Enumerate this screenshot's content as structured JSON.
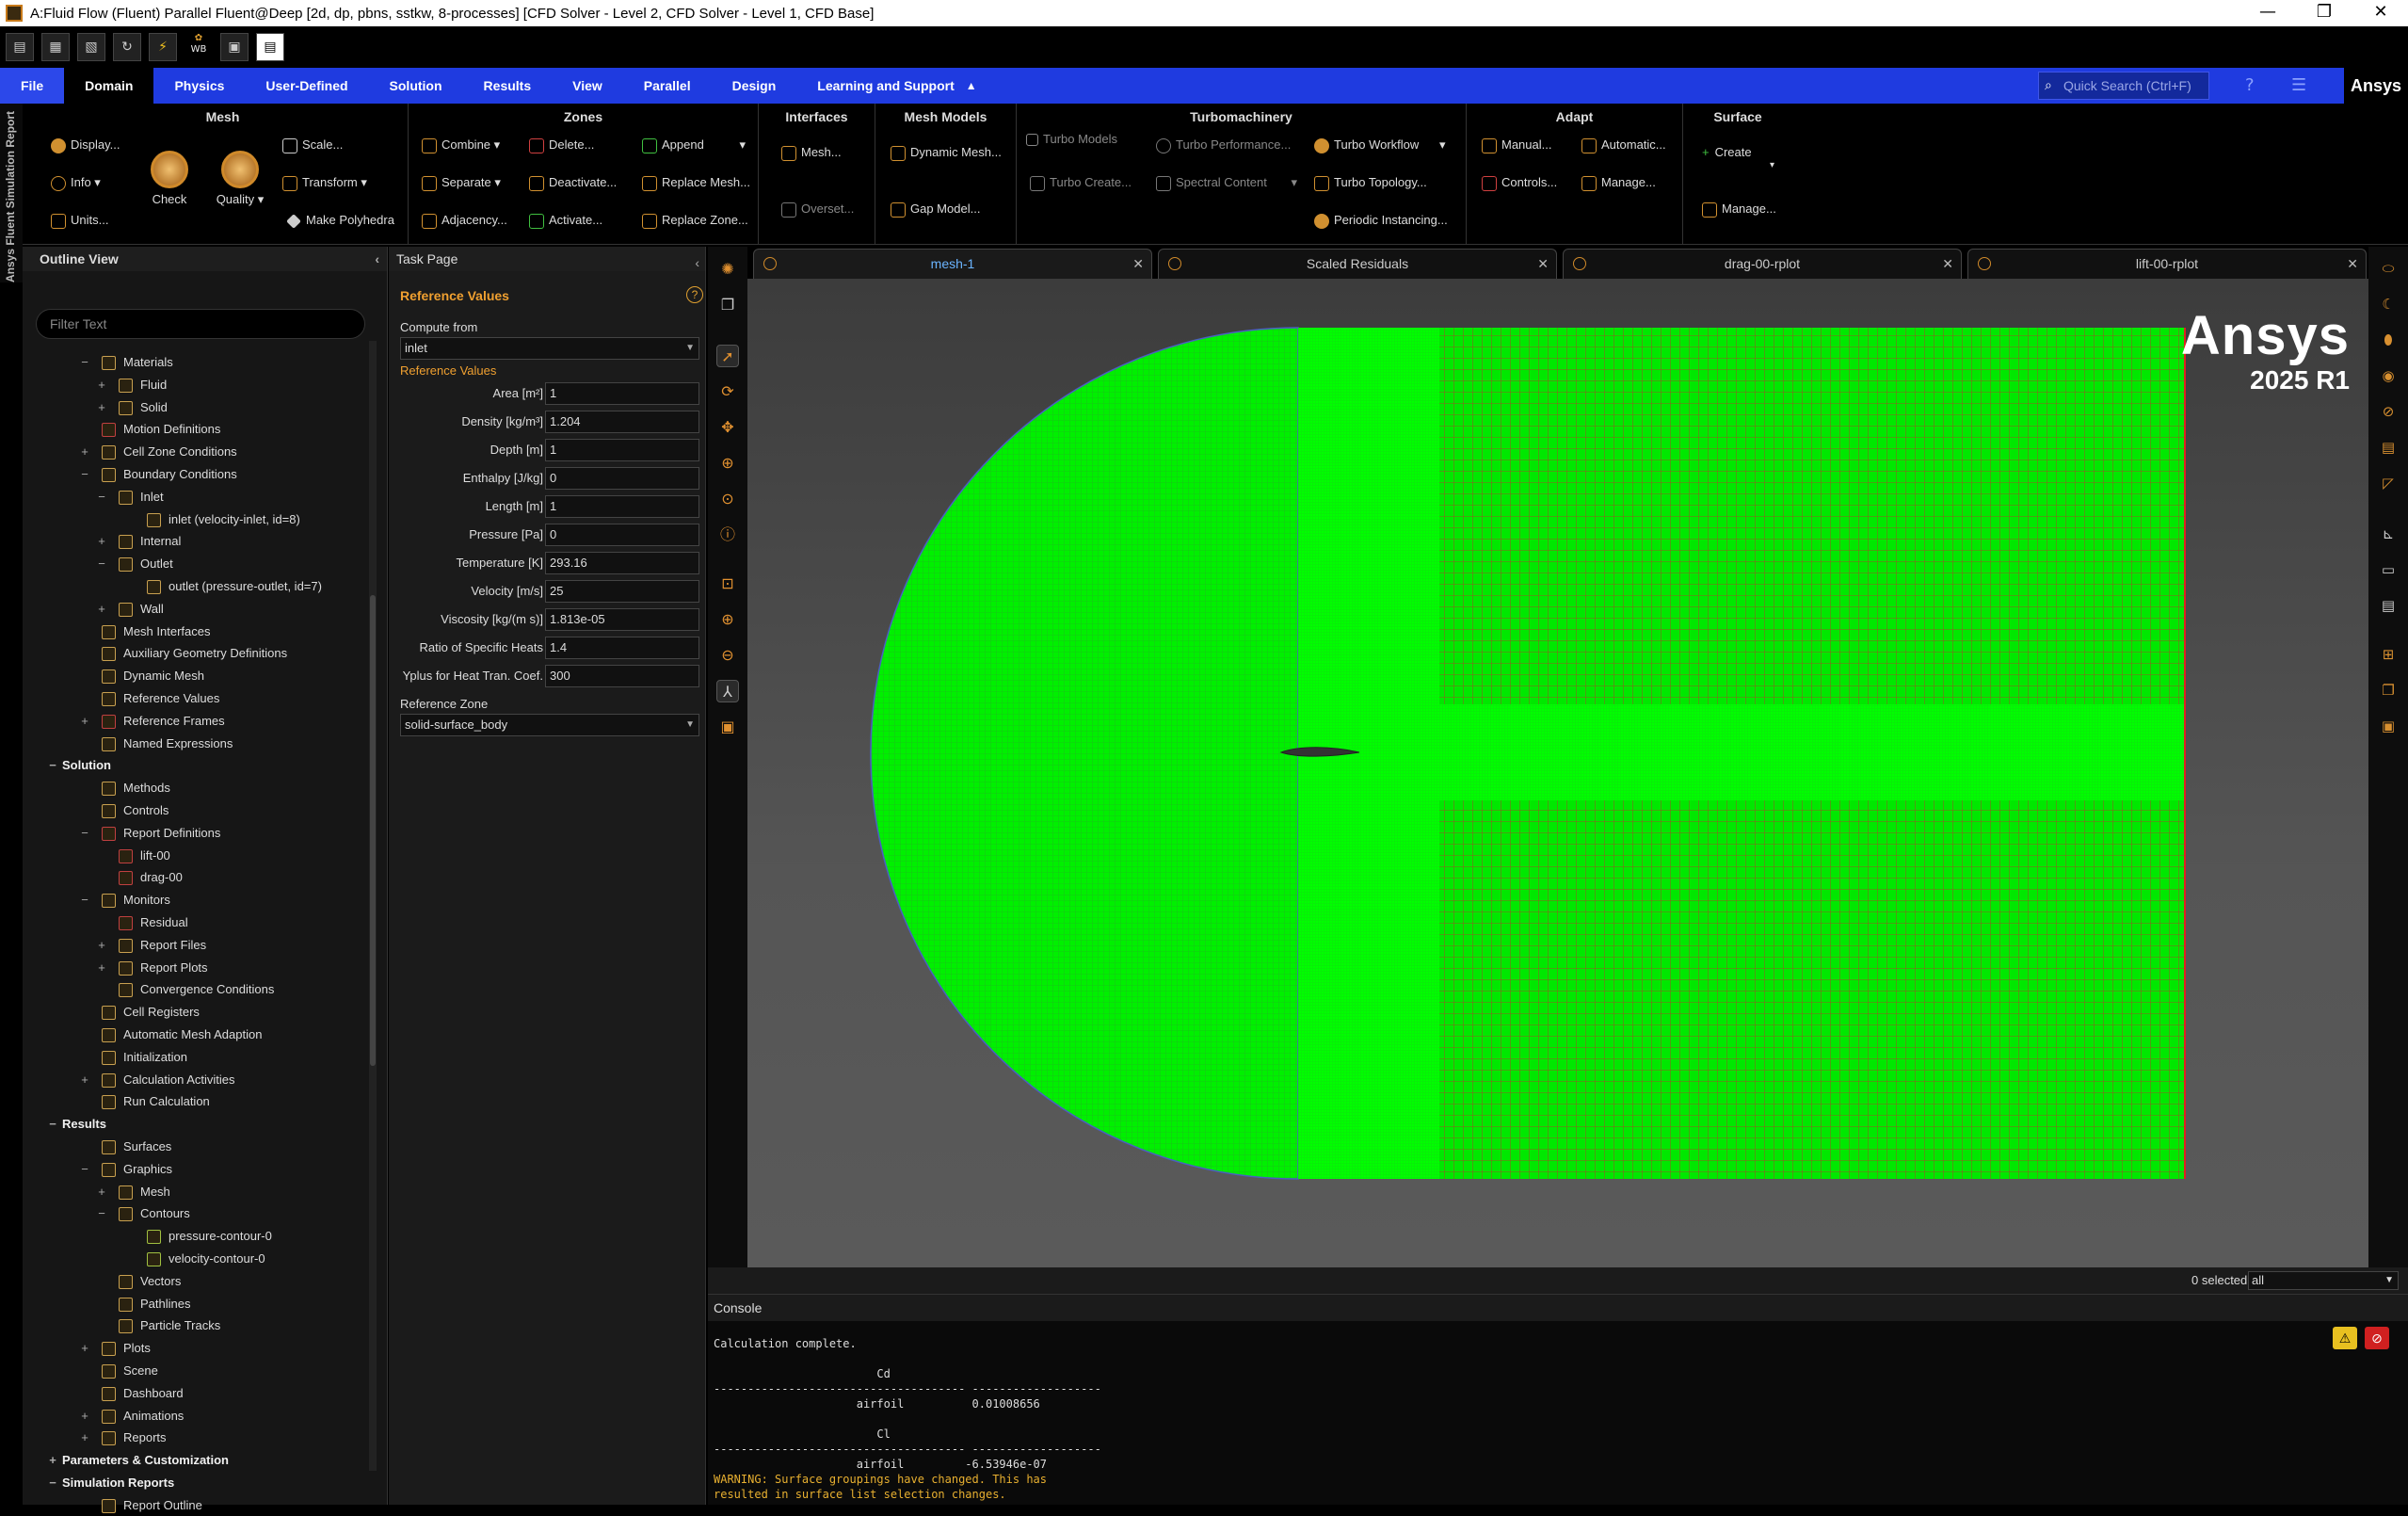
{
  "window": {
    "title": "A:Fluid Flow (Fluent) Parallel Fluent@Deep  [2d, dp, pbns, sstkw, 8-processes] [CFD Solver - Level 2, CFD Solver - Level 1, CFD Base]",
    "minimize": "—",
    "maximize": "❐",
    "close": "✕"
  },
  "qat": {
    "wb_label": "WB"
  },
  "menu": {
    "tabs": [
      "File",
      "Domain",
      "Physics",
      "User-Defined",
      "Solution",
      "Results",
      "View",
      "Parallel",
      "Design",
      "Learning and Support"
    ],
    "active": "Domain",
    "collapse": "▲",
    "search_placeholder": "Quick Search (Ctrl+F)",
    "brand": "Ansys"
  },
  "ribbon": {
    "mesh": {
      "title": "Mesh",
      "display": "Display...",
      "info": "Info",
      "units": "Units...",
      "check": "Check",
      "quality": "Quality",
      "scale": "Scale...",
      "transform": "Transform",
      "make_polyhedra": "Make Polyhedra"
    },
    "zones": {
      "title": "Zones",
      "combine": "Combine",
      "separate": "Separate",
      "adjacency": "Adjacency...",
      "delete": "Delete...",
      "deactivate": "Deactivate...",
      "activate": "Activate...",
      "append": "Append",
      "replace_mesh": "Replace Mesh...",
      "replace_zone": "Replace Zone..."
    },
    "interfaces": {
      "title": "Interfaces",
      "mesh": "Mesh...",
      "overset": "Overset..."
    },
    "mesh_models": {
      "title": "Mesh Models",
      "dynamic_mesh": "Dynamic Mesh...",
      "gap_model": "Gap Model..."
    },
    "turbomachinery": {
      "title": "Turbomachinery",
      "turbo_models": "Turbo Models",
      "turbo_create": "Turbo Create...",
      "turbo_performance": "Turbo Performance...",
      "spectral_content": "Spectral Content",
      "turbo_workflow": "Turbo Workflow",
      "turbo_topology": "Turbo Topology...",
      "periodic_instancing": "Periodic Instancing..."
    },
    "adapt": {
      "title": "Adapt",
      "manual": "Manual...",
      "automatic": "Automatic...",
      "controls": "Controls...",
      "manage": "Manage..."
    },
    "surface": {
      "title": "Surface",
      "create": "Create",
      "manage": "Manage..."
    }
  },
  "side_tab": "Ansys Fluent Simulation Report",
  "outline": {
    "title": "Outline View",
    "filter_placeholder": "Filter Text",
    "items": [
      {
        "label": "Materials",
        "exp": "−",
        "indent": 1,
        "color": "#c8a050"
      },
      {
        "label": "Fluid",
        "exp": "+",
        "indent": 2,
        "color": "#c8a050"
      },
      {
        "label": "Solid",
        "exp": "+",
        "indent": 2,
        "color": "#c8a050"
      },
      {
        "label": "Motion Definitions",
        "exp": "",
        "indent": 1,
        "color": "#c04040"
      },
      {
        "label": "Cell Zone Conditions",
        "exp": "+",
        "indent": 1,
        "color": "#c8a050"
      },
      {
        "label": "Boundary Conditions",
        "exp": "−",
        "indent": 1,
        "color": "#c8a050"
      },
      {
        "label": "Inlet",
        "exp": "−",
        "indent": 2,
        "color": "#c8a050"
      },
      {
        "label": "inlet (velocity-inlet, id=8)",
        "exp": "",
        "indent": 3,
        "color": "#c8a050"
      },
      {
        "label": "Internal",
        "exp": "+",
        "indent": 2,
        "color": "#c8a050"
      },
      {
        "label": "Outlet",
        "exp": "−",
        "indent": 2,
        "color": "#c8a050"
      },
      {
        "label": "outlet (pressure-outlet, id=7)",
        "exp": "",
        "indent": 3,
        "color": "#c8a050"
      },
      {
        "label": "Wall",
        "exp": "+",
        "indent": 2,
        "color": "#c8a050"
      },
      {
        "label": "Mesh Interfaces",
        "exp": "",
        "indent": 1,
        "color": "#c8a050"
      },
      {
        "label": "Auxiliary Geometry Definitions",
        "exp": "",
        "indent": 1,
        "color": "#c8a050"
      },
      {
        "label": "Dynamic Mesh",
        "exp": "",
        "indent": 1,
        "color": "#c8a050"
      },
      {
        "label": "Reference Values",
        "exp": "",
        "indent": 1,
        "color": "#c8a050"
      },
      {
        "label": "Reference Frames",
        "exp": "+",
        "indent": 1,
        "color": "#c04040"
      },
      {
        "label": "Named Expressions",
        "exp": "",
        "indent": 1,
        "color": "#c8a050"
      },
      {
        "label": "Solution",
        "exp": "−",
        "indent": 0,
        "sec": true
      },
      {
        "label": "Methods",
        "exp": "",
        "indent": 1,
        "color": "#c8a050"
      },
      {
        "label": "Controls",
        "exp": "",
        "indent": 1,
        "color": "#c8a050"
      },
      {
        "label": "Report Definitions",
        "exp": "−",
        "indent": 1,
        "color": "#c04040"
      },
      {
        "label": "lift-00",
        "exp": "",
        "indent": 2,
        "color": "#c04040"
      },
      {
        "label": "drag-00",
        "exp": "",
        "indent": 2,
        "color": "#c04040"
      },
      {
        "label": "Monitors",
        "exp": "−",
        "indent": 1,
        "color": "#c8a050"
      },
      {
        "label": "Residual",
        "exp": "",
        "indent": 2,
        "color": "#c04040"
      },
      {
        "label": "Report Files",
        "exp": "+",
        "indent": 2,
        "color": "#c8a050"
      },
      {
        "label": "Report Plots",
        "exp": "+",
        "indent": 2,
        "color": "#c8a050"
      },
      {
        "label": "Convergence Conditions",
        "exp": "",
        "indent": 2,
        "color": "#c8a050"
      },
      {
        "label": "Cell Registers",
        "exp": "",
        "indent": 1,
        "color": "#c8a050"
      },
      {
        "label": "Automatic Mesh Adaption",
        "exp": "",
        "indent": 1,
        "color": "#c8a050"
      },
      {
        "label": "Initialization",
        "exp": "",
        "indent": 1,
        "color": "#c8a050"
      },
      {
        "label": "Calculation Activities",
        "exp": "+",
        "indent": 1,
        "color": "#c8a050"
      },
      {
        "label": "Run Calculation",
        "exp": "",
        "indent": 1,
        "color": "#c8a050"
      },
      {
        "label": "Results",
        "exp": "−",
        "indent": 0,
        "sec": true
      },
      {
        "label": "Surfaces",
        "exp": "",
        "indent": 1,
        "color": "#c8a050"
      },
      {
        "label": "Graphics",
        "exp": "−",
        "indent": 1,
        "color": "#c8a050"
      },
      {
        "label": "Mesh",
        "exp": "+",
        "indent": 2,
        "color": "#c8a050"
      },
      {
        "label": "Contours",
        "exp": "−",
        "indent": 2,
        "color": "#c8a050"
      },
      {
        "label": "pressure-contour-0",
        "exp": "",
        "indent": 3,
        "color": "#a0c040"
      },
      {
        "label": "velocity-contour-0",
        "exp": "",
        "indent": 3,
        "color": "#a0c040"
      },
      {
        "label": "Vectors",
        "exp": "",
        "indent": 2,
        "color": "#c8a050"
      },
      {
        "label": "Pathlines",
        "exp": "",
        "indent": 2,
        "color": "#c8a050"
      },
      {
        "label": "Particle Tracks",
        "exp": "",
        "indent": 2,
        "color": "#c8a050"
      },
      {
        "label": "Plots",
        "exp": "+",
        "indent": 1,
        "color": "#c8a050"
      },
      {
        "label": "Scene",
        "exp": "",
        "indent": 1,
        "color": "#c8a050"
      },
      {
        "label": "Dashboard",
        "exp": "",
        "indent": 1,
        "color": "#c8a050"
      },
      {
        "label": "Animations",
        "exp": "+",
        "indent": 1,
        "color": "#c8a050"
      },
      {
        "label": "Reports",
        "exp": "+",
        "indent": 1,
        "color": "#c8a050"
      },
      {
        "label": "Parameters & Customization",
        "exp": "+",
        "indent": 0,
        "sec": true
      },
      {
        "label": "Simulation Reports",
        "exp": "−",
        "indent": 0,
        "sec": true
      },
      {
        "label": "Report Outline",
        "exp": "",
        "indent": 1,
        "color": "#c8a050"
      }
    ]
  },
  "task": {
    "title": "Task Page",
    "section": "Reference Values",
    "compute_from_label": "Compute from",
    "compute_from": "inlet",
    "group_label": "Reference Values",
    "rows": [
      {
        "label": "Area [m²]",
        "value": "1"
      },
      {
        "label": "Density [kg/m³]",
        "value": "1.204"
      },
      {
        "label": "Depth [m]",
        "value": "1"
      },
      {
        "label": "Enthalpy [J/kg]",
        "value": "0"
      },
      {
        "label": "Length [m]",
        "value": "1"
      },
      {
        "label": "Pressure [Pa]",
        "value": "0"
      },
      {
        "label": "Temperature [K]",
        "value": "293.16"
      },
      {
        "label": "Velocity [m/s]",
        "value": "25"
      },
      {
        "label": "Viscosity [kg/(m s)]",
        "value": "1.813e-05"
      },
      {
        "label": "Ratio of Specific Heats",
        "value": "1.4"
      },
      {
        "label": "Yplus for Heat Tran. Coef.",
        "value": "300"
      }
    ],
    "zone_label": "Reference Zone",
    "zone": "solid-surface_body"
  },
  "graphics": {
    "tabs": [
      "mesh-1",
      "Scaled Residuals",
      "drag-00-rplot",
      "lift-00-rplot"
    ],
    "active_tab": "mesh-1",
    "logo": "Ansys",
    "version": "2025 R1",
    "mesh_color": "#00ff00",
    "selected": "0 selected",
    "filter": "all"
  },
  "console": {
    "title": "Console",
    "lines": [
      "Calculation complete.",
      "",
      "                        Cd",
      "------------------------------------- -------------------",
      "                     airfoil          0.01008656",
      "",
      "                        Cl",
      "------------------------------------- -------------------",
      "                     airfoil         -6.53946e-07"
    ],
    "warning": "WARNING: Surface groupings have changed. This has\nresulted in surface list selection changes."
  }
}
